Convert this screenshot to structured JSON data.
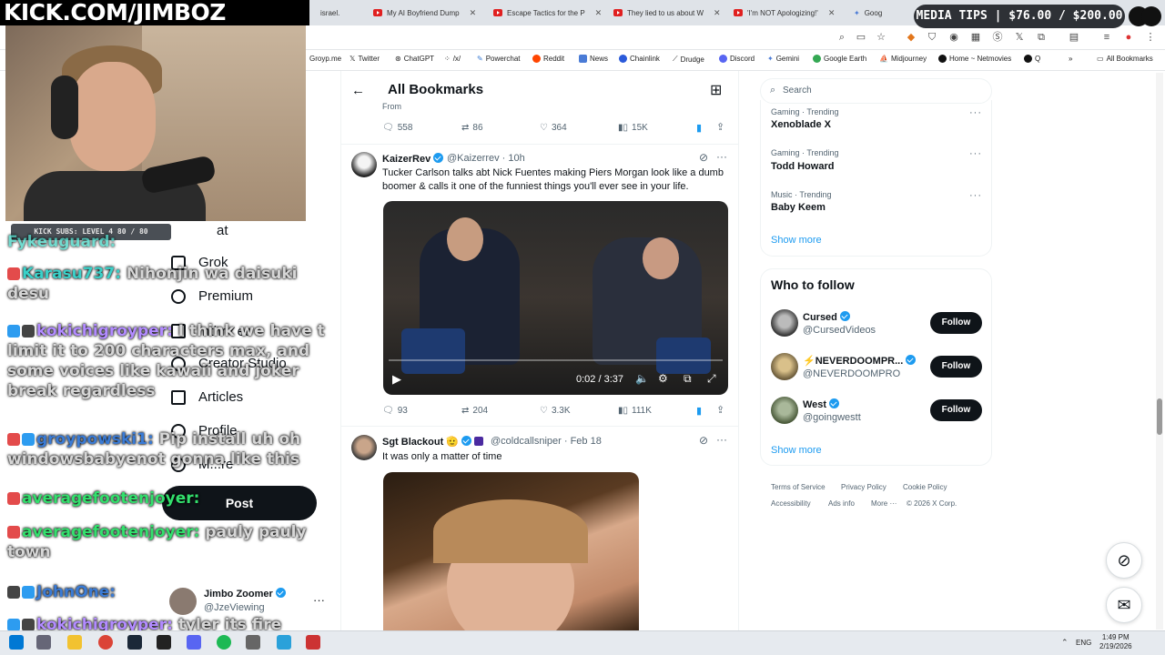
{
  "overlays": {
    "banner": "KICK.COM/JIMBOZ",
    "subs": "KICK SUBS: LEVEL 4 80 / 80",
    "media_tips": "MEDIA TIPS | $76.00 / $200.00"
  },
  "browser": {
    "tabs": [
      {
        "label": "israel."
      },
      {
        "label": "My AI Boyfriend Dump"
      },
      {
        "label": "Escape Tactics for the P"
      },
      {
        "label": "They lied to us about W"
      },
      {
        "label": "'I'm NOT Apologizing!'"
      },
      {
        "label": "Goog"
      }
    ],
    "bookmarks": [
      "Groyp.me",
      "Twitter",
      "ChatGPT",
      "/x/",
      "Powerchat",
      "Reddit",
      "News",
      "Chainlink",
      "Drudge",
      "Discord",
      "Gemini",
      "Google Earth",
      "Midjourney",
      "Home ~ Netmovies",
      "Q",
      "All Bookmarks"
    ]
  },
  "nav": {
    "items": [
      "at",
      "Grok",
      "Premium",
      "Inthr✓es",
      "Creator Studio",
      "Articles",
      "Profile",
      "M...re"
    ],
    "post_label": "Post",
    "account": {
      "name": "Jimbo Zoomer",
      "handle": "@JzeViewing"
    }
  },
  "chat": [
    {
      "user": "Fykeuguard:",
      "msg": "..."
    },
    {
      "user": "Karasu737:",
      "msg": " Nihonjin wa daisuki desu"
    },
    {
      "user": "kokichigroyper:",
      "msg": " I think we have t limit it to 200 characters max, and some voices like kawaii and joker break regardless"
    },
    {
      "user": "groypowski1:",
      "msg": " Pip install uh oh windowsbabyenot gonna like this"
    },
    {
      "user": "averagefootenjoyer:",
      "msg": ""
    },
    {
      "user": "averagefootenjoyer:",
      "msg": " pauly pauly town"
    },
    {
      "user": "JohnOne:",
      "msg": ""
    },
    {
      "user": "kokichigroyper:",
      "msg": " tyler its fire"
    }
  ],
  "feed": {
    "title": "All Bookmarks",
    "prev_metrics": {
      "replies": "558",
      "reposts": "86",
      "likes": "364",
      "views": "15K"
    },
    "prev_from": "From",
    "tweets": [
      {
        "name": "KaizerRev",
        "handle": "@Kaizerrev · 10h",
        "text": "Tucker Carlson talks abt Nick Fuentes making Piers Morgan look like a dumb boomer & calls it one of the funniest things you'll ever see in your life.",
        "video_time": "0:02 / 3:37",
        "metrics": {
          "replies": "93",
          "reposts": "204",
          "likes": "3.3K",
          "views": "111K"
        }
      },
      {
        "name": "Sgt Blackout",
        "handle": "@coldcallsniper · Feb 18",
        "text": "It was only a matter of time"
      }
    ]
  },
  "right": {
    "search_placeholder": "Search",
    "trends": [
      {
        "category": "Gaming · Trending",
        "name": "Xenoblade X"
      },
      {
        "category": "Gaming · Trending",
        "name": "Todd Howard"
      },
      {
        "category": "Music · Trending",
        "name": "Baby Keem"
      }
    ],
    "show_more": "Show more",
    "who_to_follow": "Who to follow",
    "follow_label": "Follow",
    "suggestions": [
      {
        "name": "Cursed",
        "handle": "@CursedVideos"
      },
      {
        "name": "⚡NEVERDOOMPR...",
        "handle": "@NEVERDOOMPRO"
      },
      {
        "name": "West",
        "handle": "@goingwestt"
      }
    ],
    "footer": [
      "Terms of Service",
      "Privacy Policy",
      "Cookie Policy",
      "Accessibility",
      "Ads info",
      "More ···",
      "© 2026 X Corp."
    ]
  },
  "taskbar": {
    "lang": "ENG",
    "time": "1:49 PM",
    "date": "2/19/2026"
  }
}
